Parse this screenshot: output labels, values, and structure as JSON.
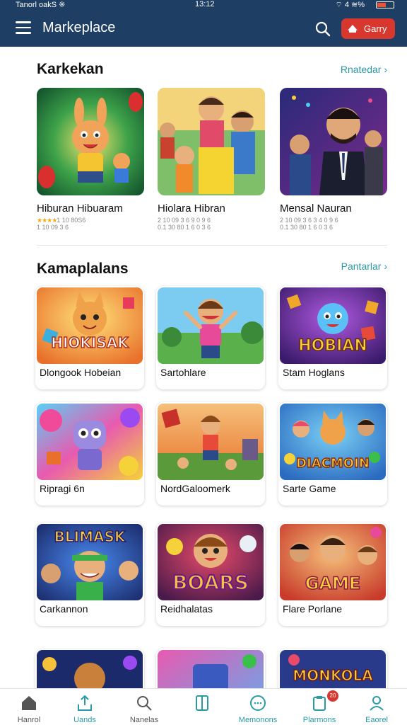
{
  "status_bar": {
    "left": "Tanorl oakS ※",
    "time": "13:12",
    "right": "⌔ 4 ≋%",
    "battery_level": 0.55
  },
  "app_bar": {
    "title": "Markeplace",
    "games_button_label": "Garry"
  },
  "section_featured": {
    "title": "Karkekan",
    "link": "Rnatedar ›",
    "items": [
      {
        "title": "Hiburan Hibuaram",
        "meta": "★★★★1 10 80S6\n1 10 09 3 6",
        "stars": 4
      },
      {
        "title": "Hiolara Hibran",
        "meta": "2 10 09 3 6 9 0 9 6\n0.1 30 80 1 6 0 3 6",
        "stars": 0
      },
      {
        "title": "Mensal Nauran",
        "meta": "2 10 09 3 6 3 4 0 9 6\n0.1 30 80 1 6 0 3 6",
        "stars": 0
      }
    ]
  },
  "section_games": {
    "title": "Kamaplalans",
    "link": "Pantarlar ›",
    "items": [
      {
        "title": "Dlongook Hobeian",
        "art_text": "HIOKISAK"
      },
      {
        "title": "Sartohlare",
        "art_text": ""
      },
      {
        "title": "Stam Hoglans",
        "art_text": "HOBIAN"
      },
      {
        "title": "Ripragi 6n",
        "art_text": ""
      },
      {
        "title": "NordGaloomerk",
        "art_text": ""
      },
      {
        "title": "Sarte Game",
        "art_text": "DIACMOIN"
      },
      {
        "title": "Carkannon",
        "art_text": "BLIMASK"
      },
      {
        "title": "Reidhalatas",
        "art_text": "BOARS"
      },
      {
        "title": "Flare Porlane",
        "art_text": "GAME"
      },
      {
        "title": "",
        "art_text": ""
      },
      {
        "title": "",
        "art_text": ""
      },
      {
        "title": "",
        "art_text": "MONKOLA"
      }
    ]
  },
  "bottom_nav": [
    {
      "label": "Hanrol",
      "icon": "home-icon",
      "active": false
    },
    {
      "label": "Uands",
      "icon": "upload-icon",
      "active": true
    },
    {
      "label": "Nanelas",
      "icon": "search-icon",
      "active": false
    },
    {
      "label": "",
      "icon": "book-icon",
      "active": true
    },
    {
      "label": "Memonons",
      "icon": "chat-icon",
      "active": true
    },
    {
      "label": "Plarmons",
      "icon": "clipboard-icon",
      "active": true,
      "badge": "20"
    },
    {
      "label": "Eaorel",
      "icon": "user-icon",
      "active": true
    }
  ],
  "colors": {
    "header": "#1f3e63",
    "accent": "#d8372e",
    "link": "#2a9aa4",
    "nav_active": "#2a9aa4"
  }
}
